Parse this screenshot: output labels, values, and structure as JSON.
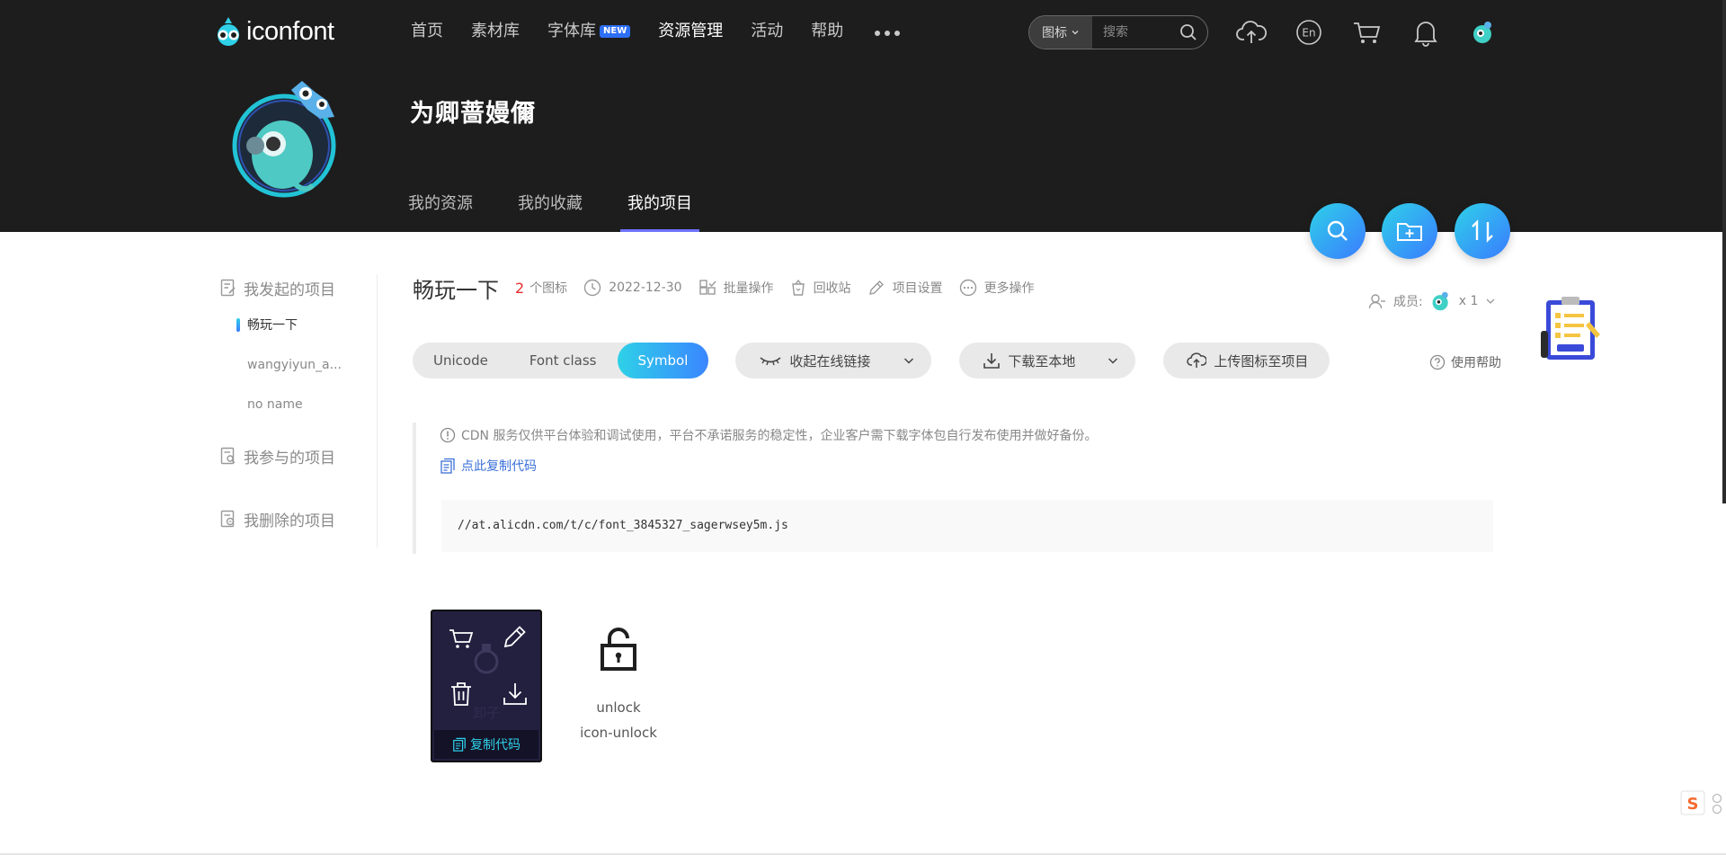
{
  "header": {
    "logo_text": "iconfont",
    "nav": [
      {
        "label": "首页"
      },
      {
        "label": "素材库"
      },
      {
        "label": "字体库",
        "badge": "NEW"
      },
      {
        "label": "资源管理"
      },
      {
        "label": "活动"
      },
      {
        "label": "帮助"
      }
    ],
    "search": {
      "type": "图标",
      "placeholder": "搜索"
    },
    "icons": [
      "upload-cloud-icon",
      "language-en-icon",
      "cart-icon",
      "bell-icon",
      "user-avatar-icon"
    ],
    "language_label": "En"
  },
  "profile": {
    "name": "为卿蔷嫚儞",
    "tabs": [
      {
        "label": "我的资源"
      },
      {
        "label": "我的收藏"
      },
      {
        "label": "我的项目",
        "active": true
      }
    ]
  },
  "sidebar": {
    "groups": [
      {
        "label": "我发起的项目",
        "items": [
          "畅玩一下",
          "wangyiyun_a...",
          "no name"
        ]
      },
      {
        "label": "我参与的项目"
      },
      {
        "label": "我删除的项目"
      }
    ]
  },
  "project": {
    "title": "畅玩一下",
    "icon_count": "2",
    "icon_count_label": "个图标",
    "date": "2022-12-30",
    "actions": {
      "batch": "批量操作",
      "recycle": "回收站",
      "settings": "项目设置",
      "more": "更多操作"
    },
    "members_label": "成员:",
    "members_count": "x 1",
    "help": "使用帮助"
  },
  "toolbar": {
    "formats": [
      "Unicode",
      "Font class",
      "Symbol"
    ],
    "active_format": "Symbol",
    "collapse_link": "收起在线链接",
    "download": "下载至本地",
    "upload": "上传图标至项目"
  },
  "notice": {
    "text": "CDN 服务仅供平台体验和调试使用，平台不承诺服务的稳定性，企业客户需下载字体包自行发布使用并做好备份。",
    "copy_label": "点此复制代码",
    "code_url": "//at.alicdn.com/t/c/font_3845327_sagerwsey5m.js"
  },
  "icons": [
    {
      "name": "卸子",
      "class": "",
      "hover_copy": "复制代码"
    },
    {
      "name": "unlock",
      "class": "icon-unlock"
    }
  ],
  "colors": {
    "header_bg": "#1d1d1d",
    "accent_gradient_start": "#2ed1e8",
    "accent_gradient_end": "#3a7bff",
    "tab_underline": "#6f74ff",
    "count_red": "#e52d2d",
    "link_blue": "#3a6fd8"
  }
}
